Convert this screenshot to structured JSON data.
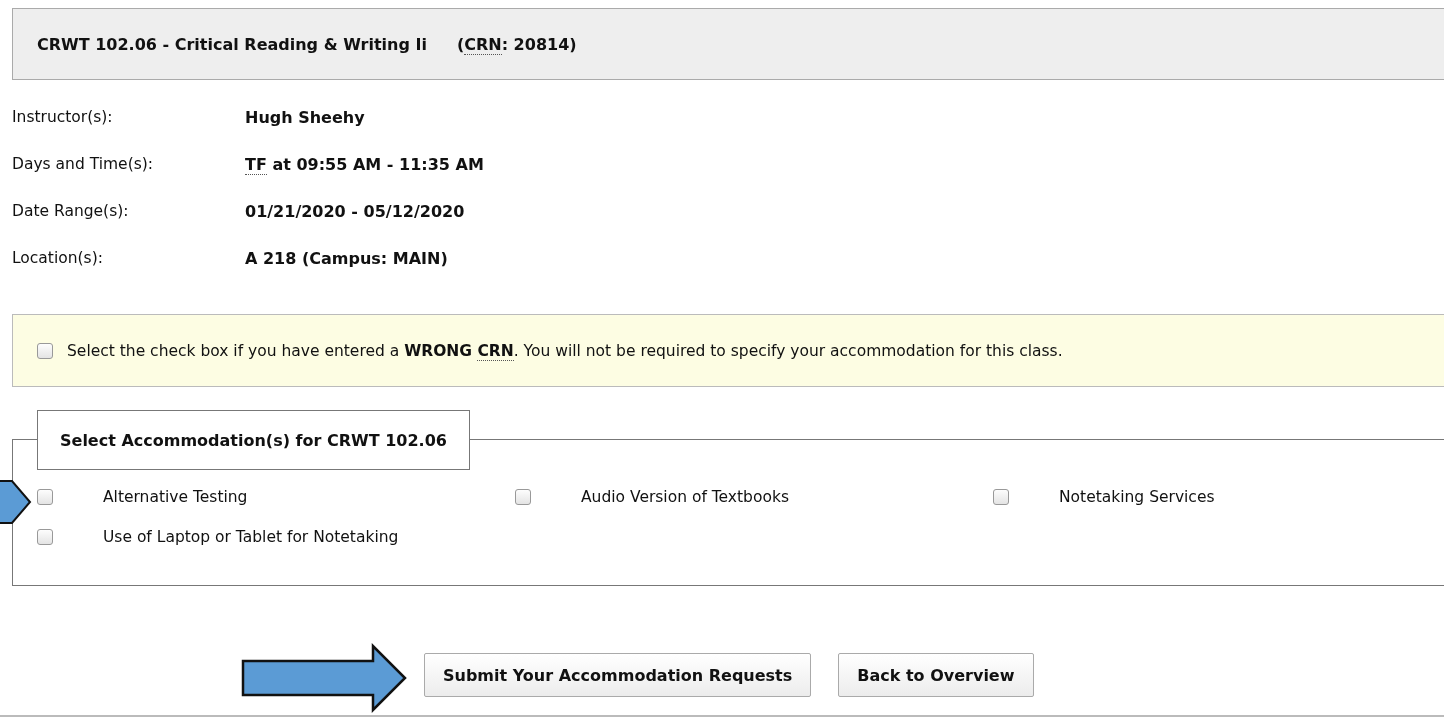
{
  "header": {
    "title": "CRWT 102.06 - Critical Reading & Writing Ii",
    "crn": [
      {
        "kind": "plain",
        "text": "("
      },
      {
        "kind": "abbr",
        "text": "CRN"
      },
      {
        "kind": "plain",
        "text": ": 20814)"
      }
    ]
  },
  "details": [
    {
      "label": "Instructor(s):",
      "value": [
        {
          "kind": "plain",
          "text": "Hugh Sheehy"
        }
      ]
    },
    {
      "label": "Days and Time(s):",
      "value": [
        {
          "kind": "abbr",
          "text": "TF"
        },
        {
          "kind": "plain",
          "text": " at 09:55 AM - 11:35 AM"
        }
      ]
    },
    {
      "label": "Date Range(s):",
      "value": [
        {
          "kind": "plain",
          "text": "01/21/2020 - 05/12/2020"
        }
      ]
    },
    {
      "label": "Location(s):",
      "value": [
        {
          "kind": "plain",
          "text": "A 218 (Campus: MAIN)"
        }
      ]
    }
  ],
  "notice": {
    "checked": false,
    "text": [
      {
        "kind": "plain",
        "text": "Select the check box if you have entered a "
      },
      {
        "kind": "bold",
        "text": "WRONG "
      },
      {
        "kind": "boldabbr",
        "text": "CRN"
      },
      {
        "kind": "plain",
        "text": ". You will not be required to specify your accommodation for this class."
      }
    ]
  },
  "accommodations": {
    "legend": "Select Accommodation(s) for CRWT 102.06",
    "options": [
      {
        "label": "Alternative Testing",
        "checked": false
      },
      {
        "label": "Audio Version of Textbooks",
        "checked": false
      },
      {
        "label": "Notetaking Services",
        "checked": false
      },
      {
        "label": "Use of Laptop or Tablet for Notetaking",
        "checked": false
      }
    ]
  },
  "buttons": [
    {
      "label": "Submit Your Accommodation Requests"
    },
    {
      "label": "Back to Overview"
    }
  ]
}
